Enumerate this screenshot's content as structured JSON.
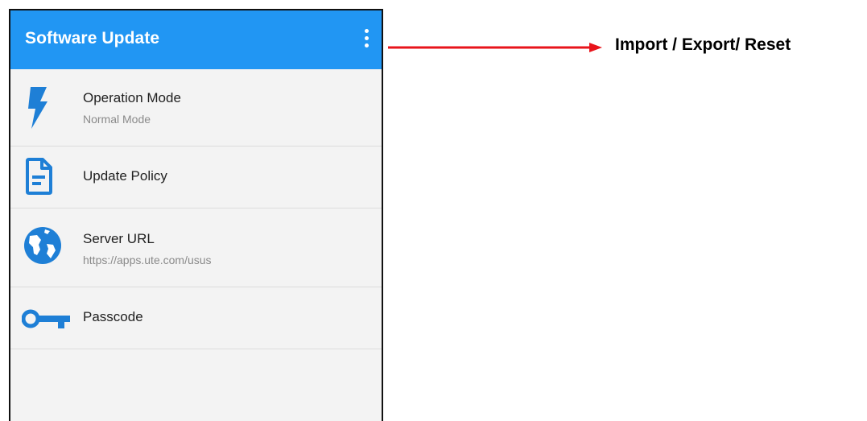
{
  "appbar": {
    "title": "Software Update",
    "overflow_icon": "more-vert-icon",
    "color": "#2196f3"
  },
  "settings": [
    {
      "label": "Operation Mode",
      "sublabel": "Normal Mode",
      "icon": "lightning-bolt-icon"
    },
    {
      "label": "Update Policy",
      "icon": "document-icon"
    },
    {
      "label": "Server URL",
      "sublabel": "https://apps.ute.com/usus",
      "icon": "globe-icon"
    },
    {
      "label": "Passcode",
      "icon": "key-icon"
    }
  ],
  "icon_color": "#1e7fd6",
  "callout": {
    "text": "Import / Export/ Reset",
    "arrow_color": "#e8141b"
  }
}
